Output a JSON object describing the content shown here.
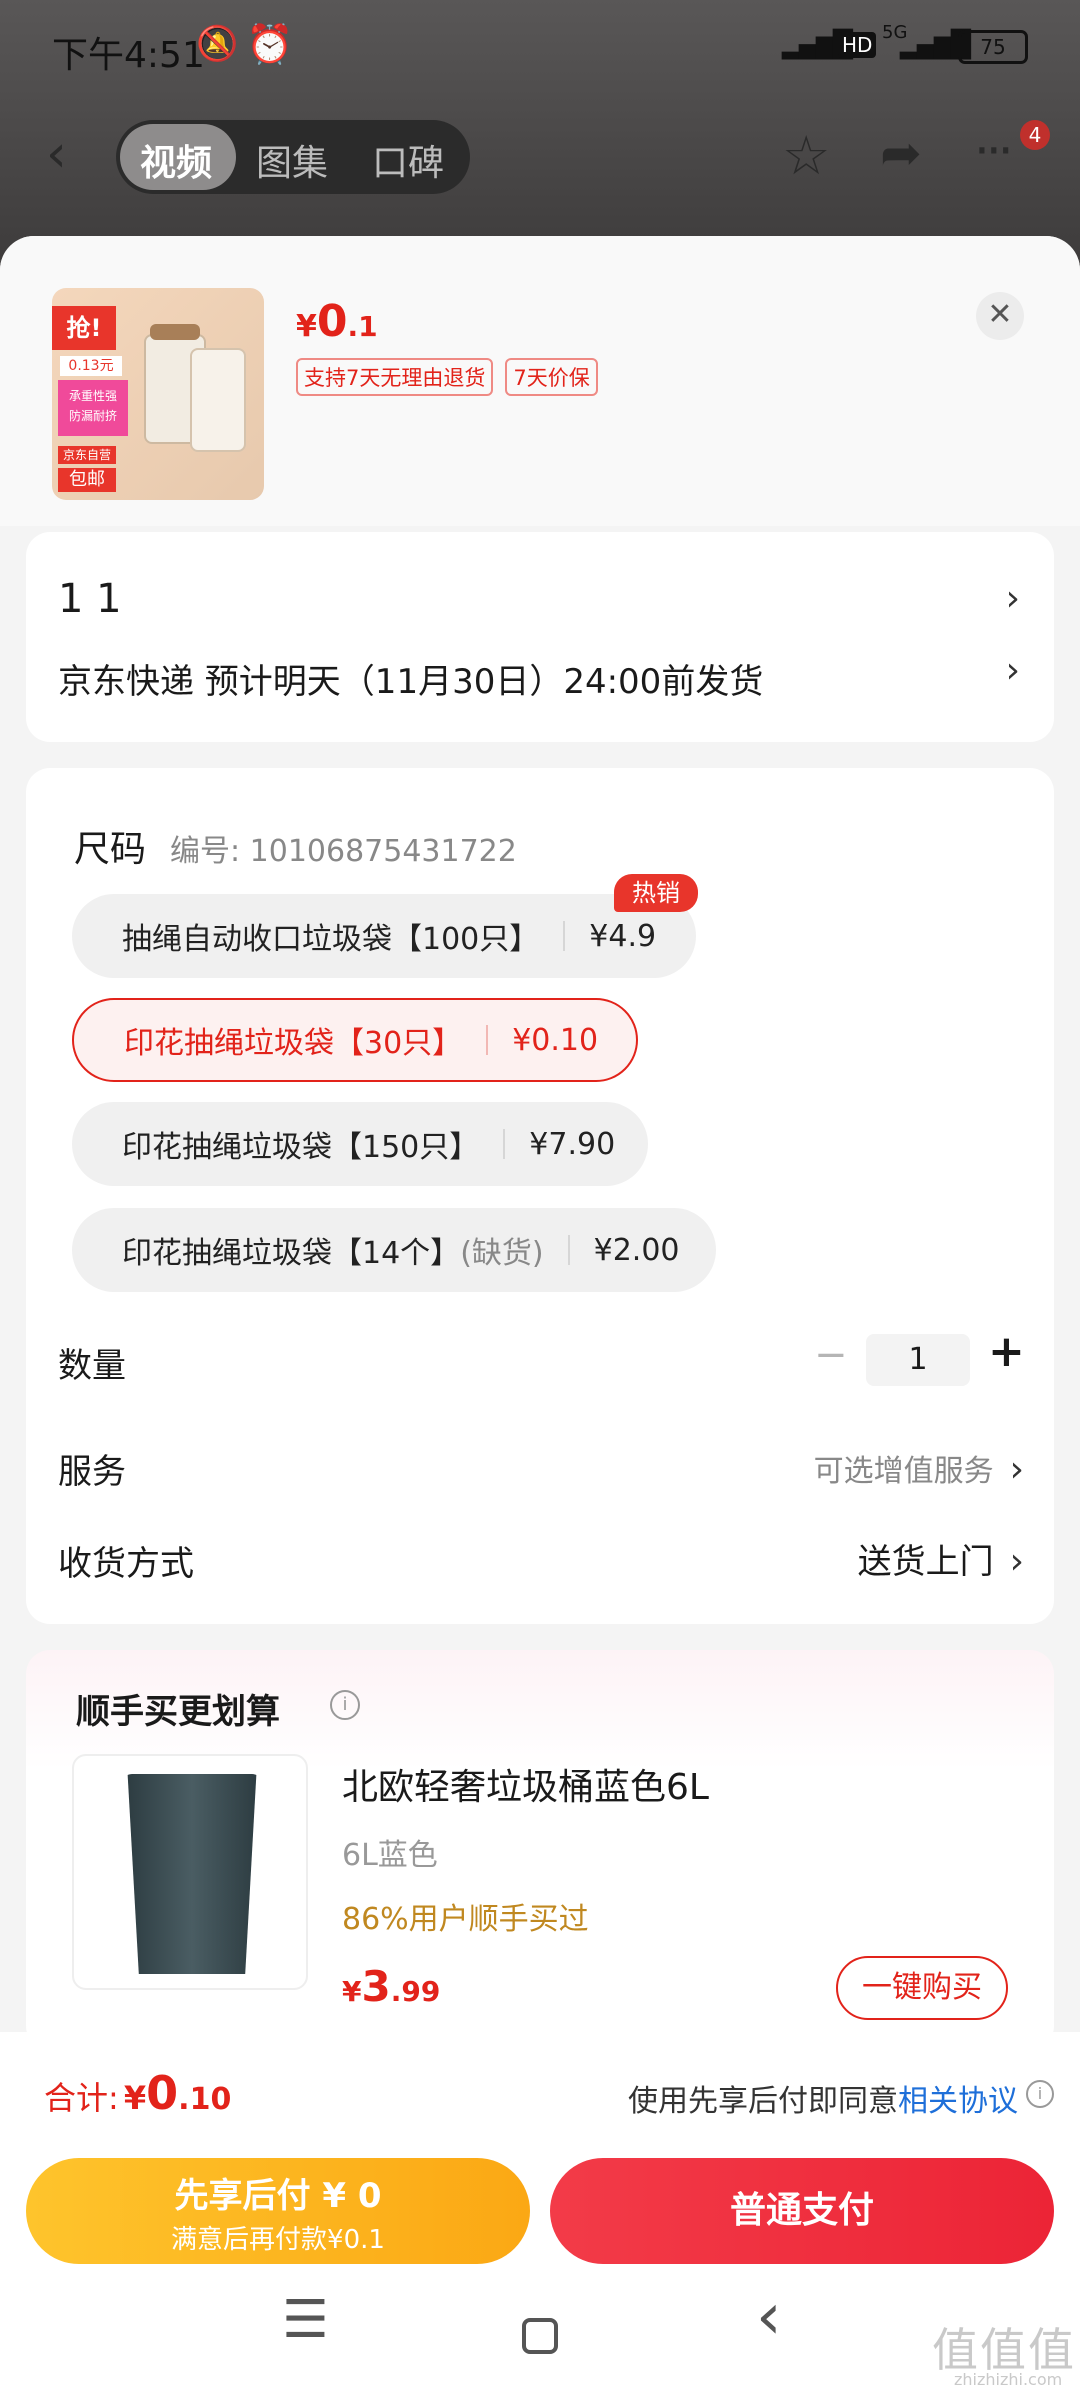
{
  "status": {
    "time": "下午4:51",
    "hd": "HD",
    "net": "5G",
    "battery": "75"
  },
  "header": {
    "tabs": [
      {
        "label": "视频"
      },
      {
        "label": "图集"
      },
      {
        "label": "口碑"
      }
    ],
    "badge": "4"
  },
  "product": {
    "thumb": {
      "sticker": "抢!",
      "price_tag": "0.13元",
      "lines": [
        "承重性强",
        "防漏耐挤"
      ],
      "brand": "京东自营",
      "ship": "包邮"
    },
    "currency": "¥",
    "price_int": "0",
    "price_dec": ".1",
    "tags": [
      "支持7天无理由退货",
      "7天价保"
    ]
  },
  "address": {
    "name": "1 1",
    "delivery": "京东快递 预计明天（11月30日）24:00前发货"
  },
  "spec": {
    "title": "尺码",
    "code": "编号: 10106875431722",
    "options": [
      {
        "name": "抽绳自动收口垃圾袋【100只】",
        "note": "",
        "price": "¥4.9",
        "badge": "热销"
      },
      {
        "name": "印花抽绳垃圾袋【30只】",
        "note": "",
        "price": "¥0.10",
        "badge": ""
      },
      {
        "name": "印花抽绳垃圾袋【150只】",
        "note": "",
        "price": "¥7.90",
        "badge": ""
      },
      {
        "name": "印花抽绳垃圾袋【14个】",
        "note": "(缺货)",
        "price": "¥2.00",
        "badge": ""
      }
    ],
    "selected_index": 1
  },
  "quantity": {
    "label": "数量",
    "value": "1",
    "minus": "−",
    "plus": "+"
  },
  "service": {
    "label": "服务",
    "value": "可选增值服务"
  },
  "receive": {
    "label": "收货方式",
    "value": "送货上门"
  },
  "bundle": {
    "title": "顺手买更划算",
    "item_title": "北欧轻奢垃圾桶蓝色6L",
    "item_spec": "6L蓝色",
    "item_stat": "86%用户顺手买过",
    "price_currency": "¥",
    "price_int": "3",
    "price_dec": ".99",
    "buy_label": "一键购买"
  },
  "footer": {
    "total_label": "合计:",
    "total_currency": "¥",
    "total_int": "0",
    "total_dec": ".10",
    "agreement_text": "使用先享后付即同意",
    "agreement_link": "相关协议",
    "pay_later_title": "先享后付 ¥ 0",
    "pay_later_sub": "满意后再付款¥0.1",
    "pay_normal": "普通支付"
  },
  "watermark": "值值值",
  "watermark_url": "zhizhizhi.com",
  "colors": {
    "accent": "#e2231a",
    "gold": "#b8860b",
    "link": "#1e6fd9",
    "pay_later": "#fcb21a",
    "pay_normal": "#f23040"
  }
}
